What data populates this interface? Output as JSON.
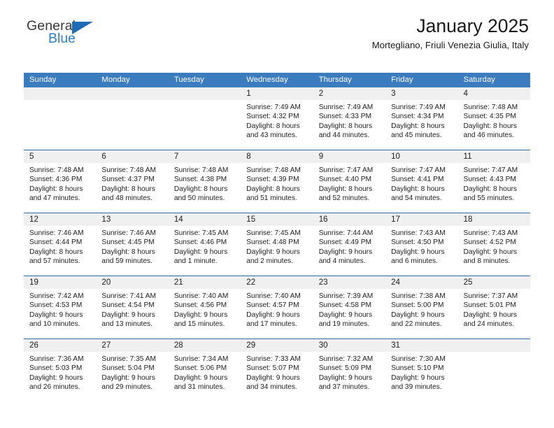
{
  "brand": {
    "name_part1": "General",
    "name_part2": "Blue",
    "colors": {
      "brand_blue": "#2e7cc4",
      "triangle_blue": "#1d6cb5",
      "header_blue": "#3a7cbe",
      "row_divider": "#2f6ca4",
      "daynum_band": "#f0f0f0"
    }
  },
  "header": {
    "title": "January 2025",
    "subtitle": "Mortegliano, Friuli Venezia Giulia, Italy"
  },
  "calendar": {
    "weekdays": [
      "Sunday",
      "Monday",
      "Tuesday",
      "Wednesday",
      "Thursday",
      "Friday",
      "Saturday"
    ],
    "weeks": [
      [
        {
          "day": "",
          "empty": true
        },
        {
          "day": "",
          "empty": true
        },
        {
          "day": "",
          "empty": true
        },
        {
          "day": "1",
          "sunrise": "Sunrise: 7:49 AM",
          "sunset": "Sunset: 4:32 PM",
          "daylight_1": "Daylight: 8 hours",
          "daylight_2": "and 43 minutes."
        },
        {
          "day": "2",
          "sunrise": "Sunrise: 7:49 AM",
          "sunset": "Sunset: 4:33 PM",
          "daylight_1": "Daylight: 8 hours",
          "daylight_2": "and 44 minutes."
        },
        {
          "day": "3",
          "sunrise": "Sunrise: 7:49 AM",
          "sunset": "Sunset: 4:34 PM",
          "daylight_1": "Daylight: 8 hours",
          "daylight_2": "and 45 minutes."
        },
        {
          "day": "4",
          "sunrise": "Sunrise: 7:48 AM",
          "sunset": "Sunset: 4:35 PM",
          "daylight_1": "Daylight: 8 hours",
          "daylight_2": "and 46 minutes."
        }
      ],
      [
        {
          "day": "5",
          "sunrise": "Sunrise: 7:48 AM",
          "sunset": "Sunset: 4:36 PM",
          "daylight_1": "Daylight: 8 hours",
          "daylight_2": "and 47 minutes."
        },
        {
          "day": "6",
          "sunrise": "Sunrise: 7:48 AM",
          "sunset": "Sunset: 4:37 PM",
          "daylight_1": "Daylight: 8 hours",
          "daylight_2": "and 48 minutes."
        },
        {
          "day": "7",
          "sunrise": "Sunrise: 7:48 AM",
          "sunset": "Sunset: 4:38 PM",
          "daylight_1": "Daylight: 8 hours",
          "daylight_2": "and 50 minutes."
        },
        {
          "day": "8",
          "sunrise": "Sunrise: 7:48 AM",
          "sunset": "Sunset: 4:39 PM",
          "daylight_1": "Daylight: 8 hours",
          "daylight_2": "and 51 minutes."
        },
        {
          "day": "9",
          "sunrise": "Sunrise: 7:47 AM",
          "sunset": "Sunset: 4:40 PM",
          "daylight_1": "Daylight: 8 hours",
          "daylight_2": "and 52 minutes."
        },
        {
          "day": "10",
          "sunrise": "Sunrise: 7:47 AM",
          "sunset": "Sunset: 4:41 PM",
          "daylight_1": "Daylight: 8 hours",
          "daylight_2": "and 54 minutes."
        },
        {
          "day": "11",
          "sunrise": "Sunrise: 7:47 AM",
          "sunset": "Sunset: 4:43 PM",
          "daylight_1": "Daylight: 8 hours",
          "daylight_2": "and 55 minutes."
        }
      ],
      [
        {
          "day": "12",
          "sunrise": "Sunrise: 7:46 AM",
          "sunset": "Sunset: 4:44 PM",
          "daylight_1": "Daylight: 8 hours",
          "daylight_2": "and 57 minutes."
        },
        {
          "day": "13",
          "sunrise": "Sunrise: 7:46 AM",
          "sunset": "Sunset: 4:45 PM",
          "daylight_1": "Daylight: 8 hours",
          "daylight_2": "and 59 minutes."
        },
        {
          "day": "14",
          "sunrise": "Sunrise: 7:45 AM",
          "sunset": "Sunset: 4:46 PM",
          "daylight_1": "Daylight: 9 hours",
          "daylight_2": "and 1 minute."
        },
        {
          "day": "15",
          "sunrise": "Sunrise: 7:45 AM",
          "sunset": "Sunset: 4:48 PM",
          "daylight_1": "Daylight: 9 hours",
          "daylight_2": "and 2 minutes."
        },
        {
          "day": "16",
          "sunrise": "Sunrise: 7:44 AM",
          "sunset": "Sunset: 4:49 PM",
          "daylight_1": "Daylight: 9 hours",
          "daylight_2": "and 4 minutes."
        },
        {
          "day": "17",
          "sunrise": "Sunrise: 7:43 AM",
          "sunset": "Sunset: 4:50 PM",
          "daylight_1": "Daylight: 9 hours",
          "daylight_2": "and 6 minutes."
        },
        {
          "day": "18",
          "sunrise": "Sunrise: 7:43 AM",
          "sunset": "Sunset: 4:52 PM",
          "daylight_1": "Daylight: 9 hours",
          "daylight_2": "and 8 minutes."
        }
      ],
      [
        {
          "day": "19",
          "sunrise": "Sunrise: 7:42 AM",
          "sunset": "Sunset: 4:53 PM",
          "daylight_1": "Daylight: 9 hours",
          "daylight_2": "and 10 minutes."
        },
        {
          "day": "20",
          "sunrise": "Sunrise: 7:41 AM",
          "sunset": "Sunset: 4:54 PM",
          "daylight_1": "Daylight: 9 hours",
          "daylight_2": "and 13 minutes."
        },
        {
          "day": "21",
          "sunrise": "Sunrise: 7:40 AM",
          "sunset": "Sunset: 4:56 PM",
          "daylight_1": "Daylight: 9 hours",
          "daylight_2": "and 15 minutes."
        },
        {
          "day": "22",
          "sunrise": "Sunrise: 7:40 AM",
          "sunset": "Sunset: 4:57 PM",
          "daylight_1": "Daylight: 9 hours",
          "daylight_2": "and 17 minutes."
        },
        {
          "day": "23",
          "sunrise": "Sunrise: 7:39 AM",
          "sunset": "Sunset: 4:58 PM",
          "daylight_1": "Daylight: 9 hours",
          "daylight_2": "and 19 minutes."
        },
        {
          "day": "24",
          "sunrise": "Sunrise: 7:38 AM",
          "sunset": "Sunset: 5:00 PM",
          "daylight_1": "Daylight: 9 hours",
          "daylight_2": "and 22 minutes."
        },
        {
          "day": "25",
          "sunrise": "Sunrise: 7:37 AM",
          "sunset": "Sunset: 5:01 PM",
          "daylight_1": "Daylight: 9 hours",
          "daylight_2": "and 24 minutes."
        }
      ],
      [
        {
          "day": "26",
          "sunrise": "Sunrise: 7:36 AM",
          "sunset": "Sunset: 5:03 PM",
          "daylight_1": "Daylight: 9 hours",
          "daylight_2": "and 26 minutes."
        },
        {
          "day": "27",
          "sunrise": "Sunrise: 7:35 AM",
          "sunset": "Sunset: 5:04 PM",
          "daylight_1": "Daylight: 9 hours",
          "daylight_2": "and 29 minutes."
        },
        {
          "day": "28",
          "sunrise": "Sunrise: 7:34 AM",
          "sunset": "Sunset: 5:06 PM",
          "daylight_1": "Daylight: 9 hours",
          "daylight_2": "and 31 minutes."
        },
        {
          "day": "29",
          "sunrise": "Sunrise: 7:33 AM",
          "sunset": "Sunset: 5:07 PM",
          "daylight_1": "Daylight: 9 hours",
          "daylight_2": "and 34 minutes."
        },
        {
          "day": "30",
          "sunrise": "Sunrise: 7:32 AM",
          "sunset": "Sunset: 5:09 PM",
          "daylight_1": "Daylight: 9 hours",
          "daylight_2": "and 37 minutes."
        },
        {
          "day": "31",
          "sunrise": "Sunrise: 7:30 AM",
          "sunset": "Sunset: 5:10 PM",
          "daylight_1": "Daylight: 9 hours",
          "daylight_2": "and 39 minutes."
        },
        {
          "day": "",
          "empty": true
        }
      ]
    ]
  }
}
